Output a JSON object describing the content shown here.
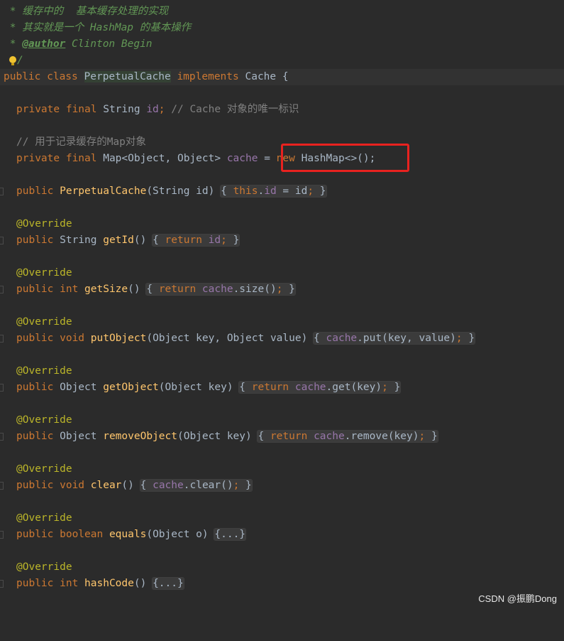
{
  "code": {
    "doc_line1": " * 缓存中的  基本缓存处理的实现",
    "doc_line2": " * 其实就是一个 HashMap 的基本操作",
    "doc_line3_prefix": " * ",
    "doc_author_tag": "@author",
    "doc_author_name": " Clinton Begin",
    "doc_end": "/",
    "class_kw": "public class ",
    "class_name": "PerpetualCache",
    "class_implements": " implements ",
    "class_iface": "Cache {",
    "id_decl_kw": "private final ",
    "id_decl_type": "String ",
    "id_decl_field": "id",
    "id_decl_semi": ";",
    "id_decl_comment": " // Cache 对象的唯一标识",
    "map_comment": "// 用于记录缓存的Map对象",
    "map_decl_kw": "private final ",
    "map_decl_type": "Map<Object, Object> ",
    "map_decl_field": "cache",
    "map_decl_eq": " = ",
    "map_decl_new": "new ",
    "map_decl_rest": "HashMap<>();",
    "ctor_kw": "public ",
    "ctor_name": "PerpetualCache",
    "ctor_params": "(String id) ",
    "ctor_body_open": "{ ",
    "ctor_this": "this",
    "ctor_dot": ".",
    "ctor_field": "id",
    "ctor_assign": " = id",
    "ctor_semi": ";",
    "ctor_close": " }",
    "override": "@Override",
    "m1_sig_kw": "public ",
    "m1_sig_type": "String ",
    "m1_name": "getId",
    "m1_paren": "() ",
    "m1_open": "{ ",
    "m1_return": "return ",
    "m1_field": "id",
    "m1_semi": ";",
    "m1_close": " }",
    "m2_sig_kw": "public int ",
    "m2_name": "getSize",
    "m2_paren": "() ",
    "m2_open": "{ ",
    "m2_return": "return ",
    "m2_field": "cache",
    "m2_rest": ".size()",
    "m2_semi": ";",
    "m2_close": " }",
    "m3_sig_kw": "public void ",
    "m3_name": "putObject",
    "m3_params": "(Object key, Object value) ",
    "m3_open": "{ ",
    "m3_field": "cache",
    "m3_rest": ".put(key, value)",
    "m3_semi": ";",
    "m3_close": " }",
    "m4_sig_kw": "public ",
    "m4_sig_type": "Object ",
    "m4_name": "getObject",
    "m4_params": "(Object key) ",
    "m4_open": "{ ",
    "m4_return": "return ",
    "m4_field": "cache",
    "m4_rest": ".get(key)",
    "m4_semi": ";",
    "m4_close": " }",
    "m5_sig_kw": "public ",
    "m5_sig_type": "Object ",
    "m5_name": "removeObject",
    "m5_params": "(Object key) ",
    "m5_open": "{ ",
    "m5_return": "return ",
    "m5_field": "cache",
    "m5_rest": ".remove(key)",
    "m5_semi": ";",
    "m5_close": " }",
    "m6_sig_kw": "public void ",
    "m6_name": "clear",
    "m6_paren": "() ",
    "m6_open": "{ ",
    "m6_field": "cache",
    "m6_rest": ".clear()",
    "m6_semi": ";",
    "m6_close": " }",
    "m7_sig_kw": "public boolean ",
    "m7_name": "equals",
    "m7_params": "(Object o) ",
    "m7_folded": "{...}",
    "m8_sig_kw": "public int ",
    "m8_name": "hashCode",
    "m8_paren": "() ",
    "m8_folded": "{...}"
  },
  "watermark": "CSDN @振鹏Dong",
  "colors": {
    "background": "#2b2b2b",
    "keyword": "#cc7832",
    "annotation": "#bbb529",
    "method": "#ffc66d",
    "field": "#9876aa",
    "doc": "#629755",
    "highlight_box": "#e8221f"
  },
  "icons": [
    "intention-bulb-icon",
    "fold-marker-icon"
  ]
}
